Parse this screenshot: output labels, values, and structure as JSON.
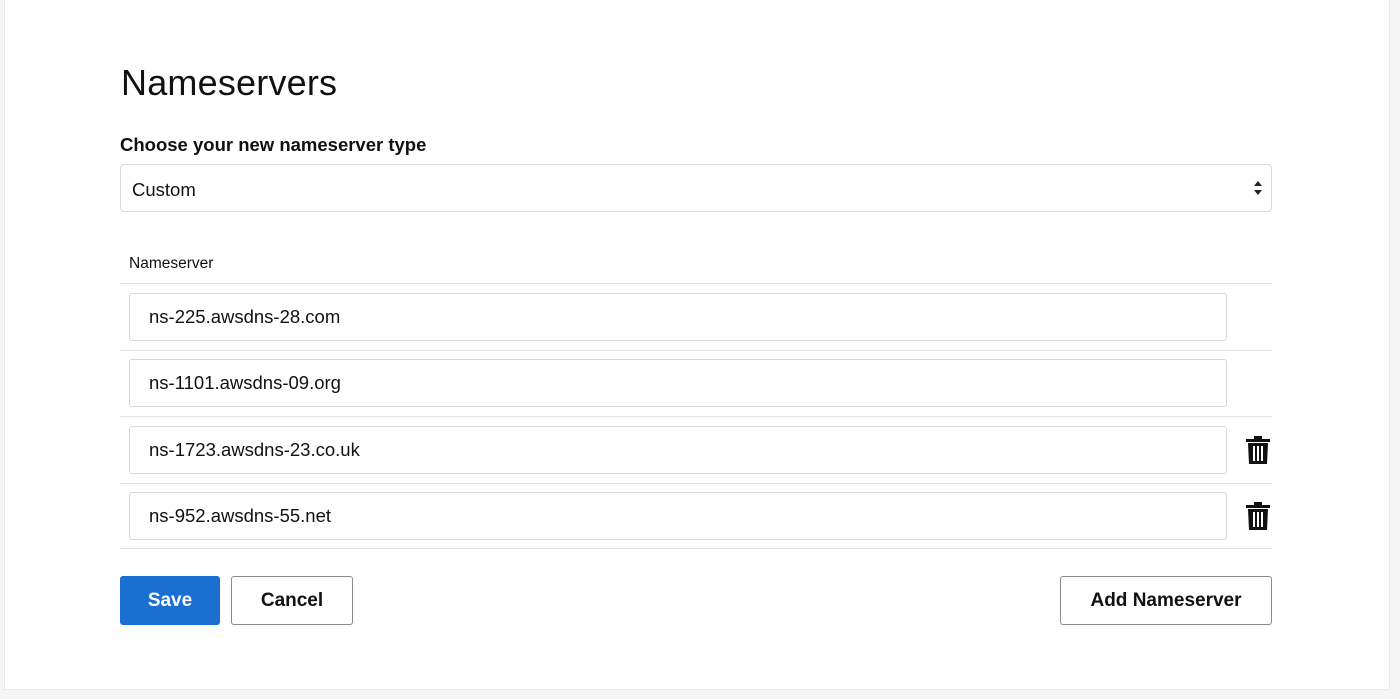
{
  "page": {
    "title": "Nameservers"
  },
  "type_select": {
    "label": "Choose your new nameserver type",
    "value": "Custom"
  },
  "nameservers": {
    "column_header": "Nameserver",
    "rows": [
      {
        "value": "ns-225.awsdns-28.com",
        "deletable": false
      },
      {
        "value": "ns-1101.awsdns-09.org",
        "deletable": false
      },
      {
        "value": "ns-1723.awsdns-23.co.uk",
        "deletable": true,
        "delete_icon": "trash-icon"
      },
      {
        "value": "ns-952.awsdns-55.net",
        "deletable": true,
        "delete_icon": "trash-icon"
      }
    ]
  },
  "actions": {
    "save_label": "Save",
    "cancel_label": "Cancel",
    "add_label": "Add Nameserver"
  },
  "colors": {
    "primary": "#1b6fd1",
    "text": "#111111",
    "border": "#d9d9d9"
  }
}
